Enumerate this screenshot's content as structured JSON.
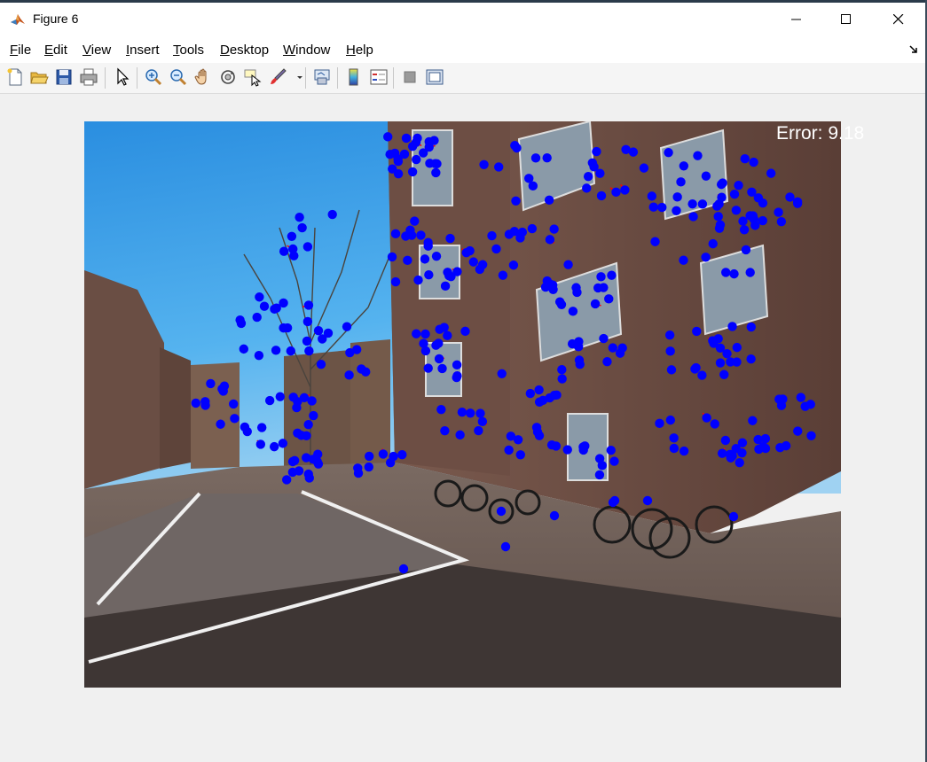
{
  "window": {
    "title": "Figure 6"
  },
  "menu": [
    {
      "first": "F",
      "rest": "ile"
    },
    {
      "first": "E",
      "rest": "dit"
    },
    {
      "first": "V",
      "rest": "iew"
    },
    {
      "first": "I",
      "rest": "nsert"
    },
    {
      "first": "T",
      "rest": "ools"
    },
    {
      "first": "D",
      "rest": "esktop"
    },
    {
      "first": "W",
      "rest": "indow"
    },
    {
      "first": "H",
      "rest": "elp"
    }
  ],
  "toolbar": {
    "icons": [
      "new-figure-icon",
      "open-file-icon",
      "save-icon",
      "print-icon",
      "select-arrow-icon",
      "zoom-in-icon",
      "zoom-out-icon",
      "pan-hand-icon",
      "rotate-3d-icon",
      "data-cursor-icon",
      "brush-icon",
      "link-plot-icon",
      "colorbar-icon",
      "legend-icon",
      "hide-plot-tools-icon",
      "show-plot-tools-icon"
    ]
  },
  "plot": {
    "error_text": "Error: 9.18",
    "marker_color": "#0000ff",
    "residual_color": "#ff0000"
  }
}
